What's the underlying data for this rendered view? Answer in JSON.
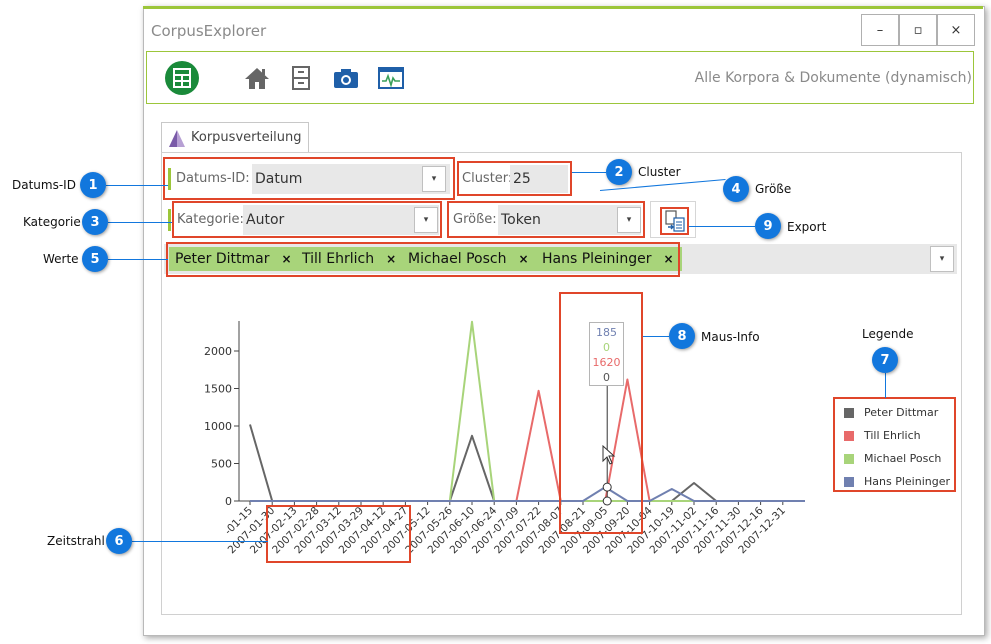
{
  "window": {
    "title": "CorpusExplorer",
    "controls": {
      "minimize": "–",
      "maximize": "▫",
      "close": "×"
    },
    "accent_color": "#9cc63a"
  },
  "toolbar": {
    "icons": [
      "corpusexplorer-logo-icon",
      "home-icon",
      "cabinet-icon",
      "camera-icon",
      "monitor-icon"
    ],
    "context_label": "Alle Korpora & Dokumente (dynamisch)"
  },
  "tab": {
    "label": "Korpusverteilung"
  },
  "filters": {
    "datum_label": "Datums-ID:",
    "datum_value": "Datum",
    "cluster_label": "Cluster:",
    "cluster_value": "25",
    "kategorie_label": "Kategorie:",
    "kategorie_value": "Autor",
    "groesse_label": "Größe:",
    "groesse_value": "Token",
    "dropdown_arrow": "▾"
  },
  "values": {
    "remove_glyph": "×",
    "tags": [
      "Peter Dittmar",
      "Till Ehrlich",
      "Michael Posch",
      "Hans Pleininger"
    ]
  },
  "tooltip": {
    "values": [
      "185",
      "0",
      "1620",
      "0"
    ]
  },
  "legend": {
    "items": [
      {
        "name": "Peter Dittmar",
        "color": "#666666"
      },
      {
        "name": "Till Ehrlich",
        "color": "#e86a6a"
      },
      {
        "name": "Michael Posch",
        "color": "#a8d47a"
      },
      {
        "name": "Hans Pleininger",
        "color": "#7080b0"
      }
    ]
  },
  "callouts": [
    {
      "num": "1",
      "text": "Datums-ID"
    },
    {
      "num": "2",
      "text": "Cluster"
    },
    {
      "num": "3",
      "text": "Kategorie"
    },
    {
      "num": "4",
      "text": "Größe"
    },
    {
      "num": "5",
      "text": "Werte"
    },
    {
      "num": "6",
      "text": "Zeitstrahl"
    },
    {
      "num": "7",
      "text": "Legende"
    },
    {
      "num": "8",
      "text": "Maus-Info"
    },
    {
      "num": "9",
      "text": "Export"
    }
  ],
  "chart_data": {
    "type": "line",
    "title": "",
    "xlabel": "",
    "ylabel": "",
    "ylim": [
      0,
      2400
    ],
    "yticks": [
      0,
      500,
      1000,
      1500,
      2000
    ],
    "first_label": "-01-15",
    "categories": [
      "2007-01-15",
      "2007-01-30",
      "2007-02-13",
      "2007-02-28",
      "2007-03-12",
      "2007-03-29",
      "2007-04-12",
      "2007-04-27",
      "2007-05-12",
      "2007-05-26",
      "2007-06-10",
      "2007-06-24",
      "2007-07-09",
      "2007-07-22",
      "2007-08-07",
      "2007-08-21",
      "2007-09-05",
      "2007-09-20",
      "2007-10-04",
      "2007-10-19",
      "2007-11-02",
      "2007-11-16",
      "2007-11-30",
      "2007-12-16",
      "2007-12-31"
    ],
    "series": [
      {
        "name": "Peter Dittmar",
        "color": "#666666",
        "values": [
          1020,
          0,
          0,
          0,
          0,
          0,
          0,
          0,
          0,
          0,
          870,
          0,
          0,
          0,
          0,
          0,
          0,
          0,
          0,
          0,
          240,
          0,
          0,
          0,
          0,
          0
        ]
      },
      {
        "name": "Till Ehrlich",
        "color": "#e86a6a",
        "values": [
          0,
          0,
          0,
          0,
          0,
          0,
          0,
          0,
          0,
          0,
          0,
          0,
          0,
          1470,
          0,
          0,
          0,
          1620,
          0,
          0,
          0,
          0,
          0,
          0,
          0,
          0
        ]
      },
      {
        "name": "Michael Posch",
        "color": "#a8d47a",
        "values": [
          0,
          0,
          0,
          0,
          0,
          0,
          0,
          0,
          0,
          0,
          2390,
          0,
          0,
          0,
          0,
          0,
          0,
          0,
          0,
          0,
          0,
          0,
          0,
          0,
          0,
          0
        ]
      },
      {
        "name": "Hans Pleininger",
        "color": "#7080b0",
        "values": [
          0,
          0,
          0,
          0,
          0,
          0,
          0,
          0,
          0,
          0,
          0,
          0,
          0,
          0,
          0,
          0,
          185,
          0,
          0,
          160,
          0,
          0,
          0,
          0,
          0,
          0
        ]
      }
    ]
  }
}
